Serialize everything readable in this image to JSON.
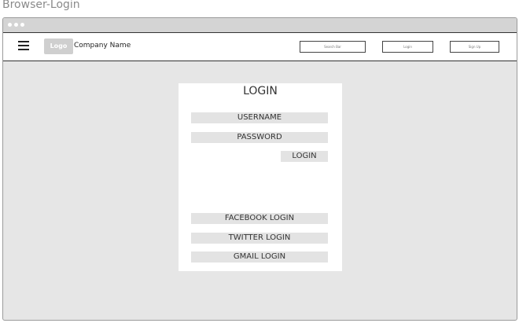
{
  "page": {
    "title": "Browser-Login"
  },
  "navbar": {
    "company_name": "Company Name",
    "logo_text": "Logo",
    "search_label": "Search Bar",
    "login_label": "Login",
    "signup_label": "Sign Up"
  },
  "login_card": {
    "title": "LOGIN",
    "username_label": "USERNAME",
    "password_label": "PASSWORD",
    "login_button": "LOGIN",
    "social": {
      "facebook": "FACEBOOK LOGIN",
      "twitter": "TWITTER LOGIN",
      "gmail": "GMAIL LOGIN"
    }
  },
  "icons": {
    "menu": "hamburger-menu-icon",
    "window_controls": "window-dots-icon"
  },
  "colors": {
    "window_bg": "#e6e6e6",
    "card_bg": "#ffffff",
    "field_bg": "#e3e3e3",
    "logo_bg": "#cfcfcf"
  }
}
